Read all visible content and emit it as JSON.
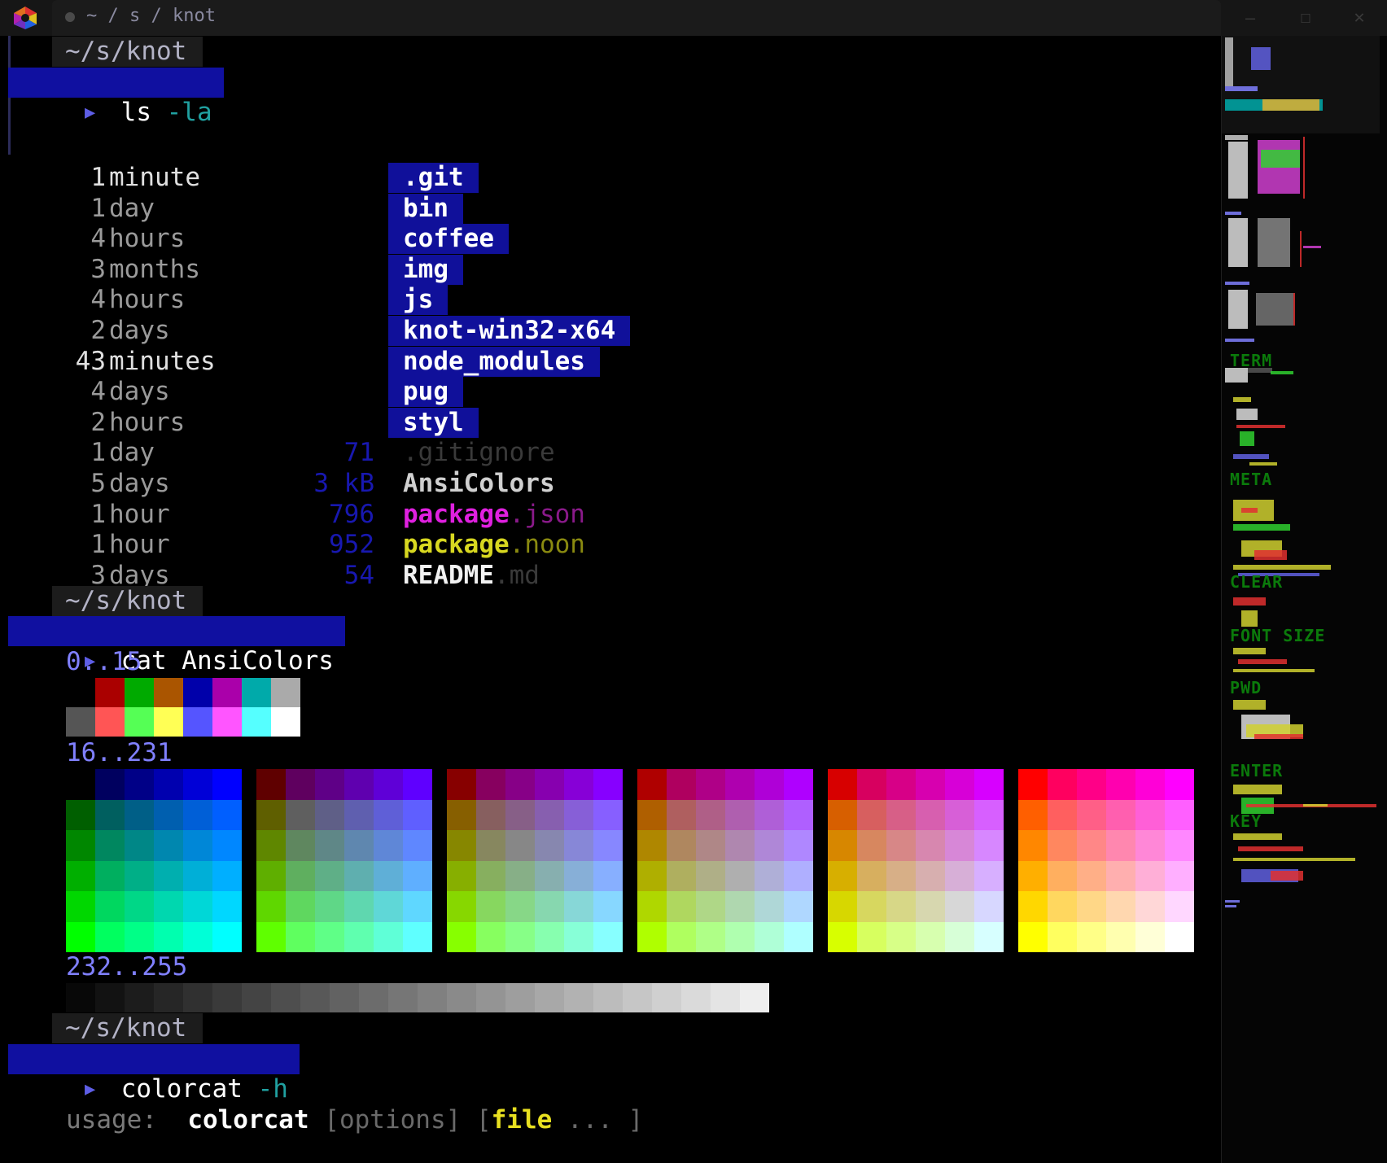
{
  "window": {
    "tab_path": "~ / s / knot",
    "controls": {
      "minimize": "—",
      "maximize": "☐",
      "close": "✕"
    }
  },
  "prompts": [
    {
      "path": "~/s/knot",
      "command": "ls",
      "args": " -la"
    },
    {
      "path": "~/s/knot",
      "command": "cat AnsiColors",
      "args": ""
    },
    {
      "path": "~/s/knot",
      "command": "colorcat",
      "args": " -h"
    }
  ],
  "listing": {
    "dirs": [
      {
        "num": "1",
        "unit": "minute",
        "name": ".git",
        "bright": true
      },
      {
        "num": "1",
        "unit": "day",
        "name": "bin",
        "bright": false
      },
      {
        "num": "4",
        "unit": "hours",
        "name": "coffee",
        "bright": false
      },
      {
        "num": "3",
        "unit": "months",
        "name": "img",
        "bright": false
      },
      {
        "num": "4",
        "unit": "hours",
        "name": "js",
        "bright": false
      },
      {
        "num": "2",
        "unit": "days",
        "name": "knot-win32-x64",
        "bright": false
      },
      {
        "num": "43",
        "unit": "minutes",
        "name": "node_modules",
        "bright": true
      },
      {
        "num": "4",
        "unit": "days",
        "name": "pug",
        "bright": false
      },
      {
        "num": "2",
        "unit": "hours",
        "name": "styl",
        "bright": false
      }
    ],
    "files": [
      {
        "num": "1",
        "unit": "day",
        "size": "71",
        "name": "",
        "ext": ".gitignore",
        "name_color": "#3a3a3a",
        "ext_color": "#3a3a3a"
      },
      {
        "num": "5",
        "unit": "days",
        "size": "3 kB",
        "name": "AnsiColors",
        "ext": "",
        "name_color": "#d0d0d0",
        "ext_color": "#d0d0d0"
      },
      {
        "num": "1",
        "unit": "hour",
        "size": "796",
        "name": "package",
        "ext": ".json",
        "name_color": "#e020e0",
        "ext_color": "#8a1a8a"
      },
      {
        "num": "1",
        "unit": "hour",
        "size": "952",
        "name": "package",
        "ext": ".noon",
        "name_color": "#d8d820",
        "ext_color": "#8a8a10"
      },
      {
        "num": "3",
        "unit": "days",
        "size": "54",
        "name": "README",
        "ext": ".md",
        "name_color": "#f2f2f2",
        "ext_color": "#3a3a3a"
      }
    ]
  },
  "ansi": {
    "label_basic": "0..15",
    "label_cube": "16..231",
    "label_gray": "232..255"
  },
  "usage": {
    "label": "usage:",
    "command": "colorcat",
    "options": "[options]",
    "bracket_open": "[",
    "file": "file",
    "ellipsis": " ... ]"
  },
  "minimap": {
    "labels": [
      "TERM",
      "META",
      "CLEAR",
      "FONT SIZE",
      "PWD",
      "ENTER",
      "KEY"
    ]
  }
}
